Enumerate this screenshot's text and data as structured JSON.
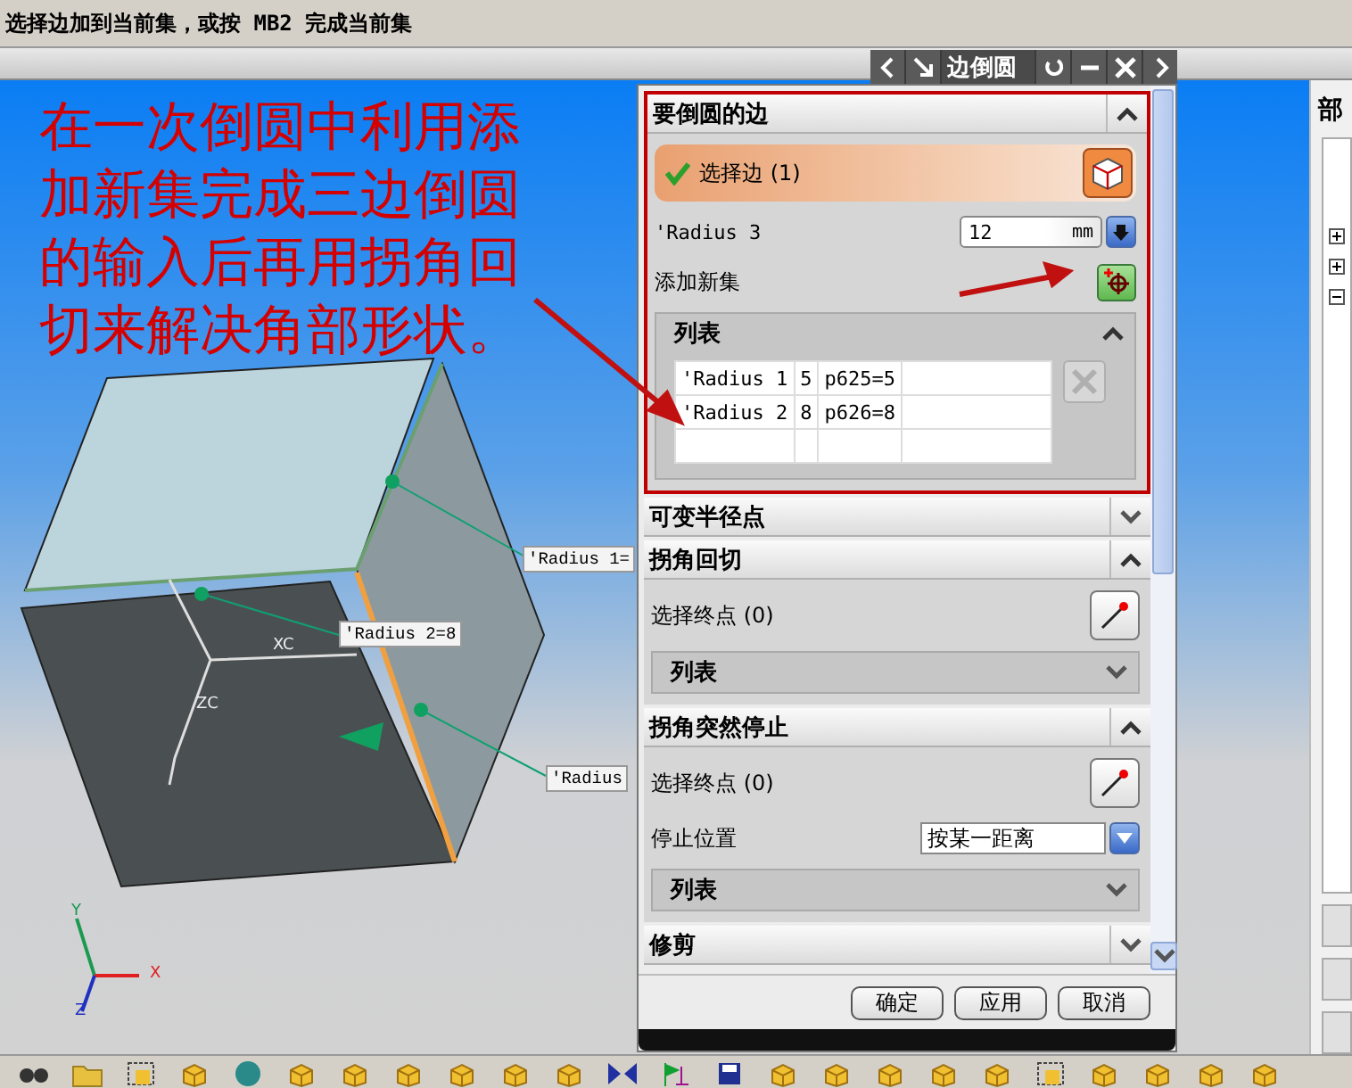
{
  "status_bar": {
    "prompt": "选择边加到当前集，或按 MB2 完成当前集"
  },
  "annotation": "在一次倒圆中利用添加新集完成三边倒圆的输入后再用拐角回切来解决角部形状。",
  "callouts": [
    {
      "text": "'Radius 1="
    },
    {
      "text": "'Radius 2=8"
    },
    {
      "text": "'Radius"
    }
  ],
  "wcs_labels": [
    "XC",
    "ZC"
  ],
  "triad_labels": [
    "Y",
    "X",
    "Z"
  ],
  "dialog": {
    "title": "边倒圆",
    "sections": [
      {
        "title": "要倒圆的边",
        "expanded": true,
        "highlighted": true,
        "rows": [
          {
            "kind": "select",
            "label": "选择边 (1)",
            "done": true
          },
          {
            "kind": "expression",
            "label": "'Radius 3",
            "value": "12",
            "unit": "mm"
          },
          {
            "kind": "add",
            "label": "添加新集"
          },
          {
            "kind": "list",
            "title": "列表",
            "expanded": true,
            "delete_disabled": true,
            "rows": [
              {
                "name": "'Radius 1",
                "value": "5",
                "expression": "p625=5"
              },
              {
                "name": "'Radius 2",
                "value": "8",
                "expression": "p626=8"
              }
            ]
          }
        ]
      },
      {
        "title": "可变半径点",
        "expanded": false
      },
      {
        "title": "拐角回切",
        "expanded": true,
        "rows": [
          {
            "kind": "point",
            "label": "选择终点 (0)"
          },
          {
            "kind": "list",
            "title": "列表",
            "expanded": false
          }
        ]
      },
      {
        "title": "拐角突然停止",
        "expanded": true,
        "rows": [
          {
            "kind": "point",
            "label": "选择终点 (0)"
          },
          {
            "kind": "dropdown",
            "label": "停止位置",
            "value": "按某一距离"
          },
          {
            "kind": "list",
            "title": "列表",
            "expanded": false
          }
        ]
      },
      {
        "title": "修剪",
        "expanded": false
      }
    ],
    "buttons": [
      "确定",
      "应用",
      "取消"
    ]
  },
  "right_panel": {
    "title": "部"
  }
}
